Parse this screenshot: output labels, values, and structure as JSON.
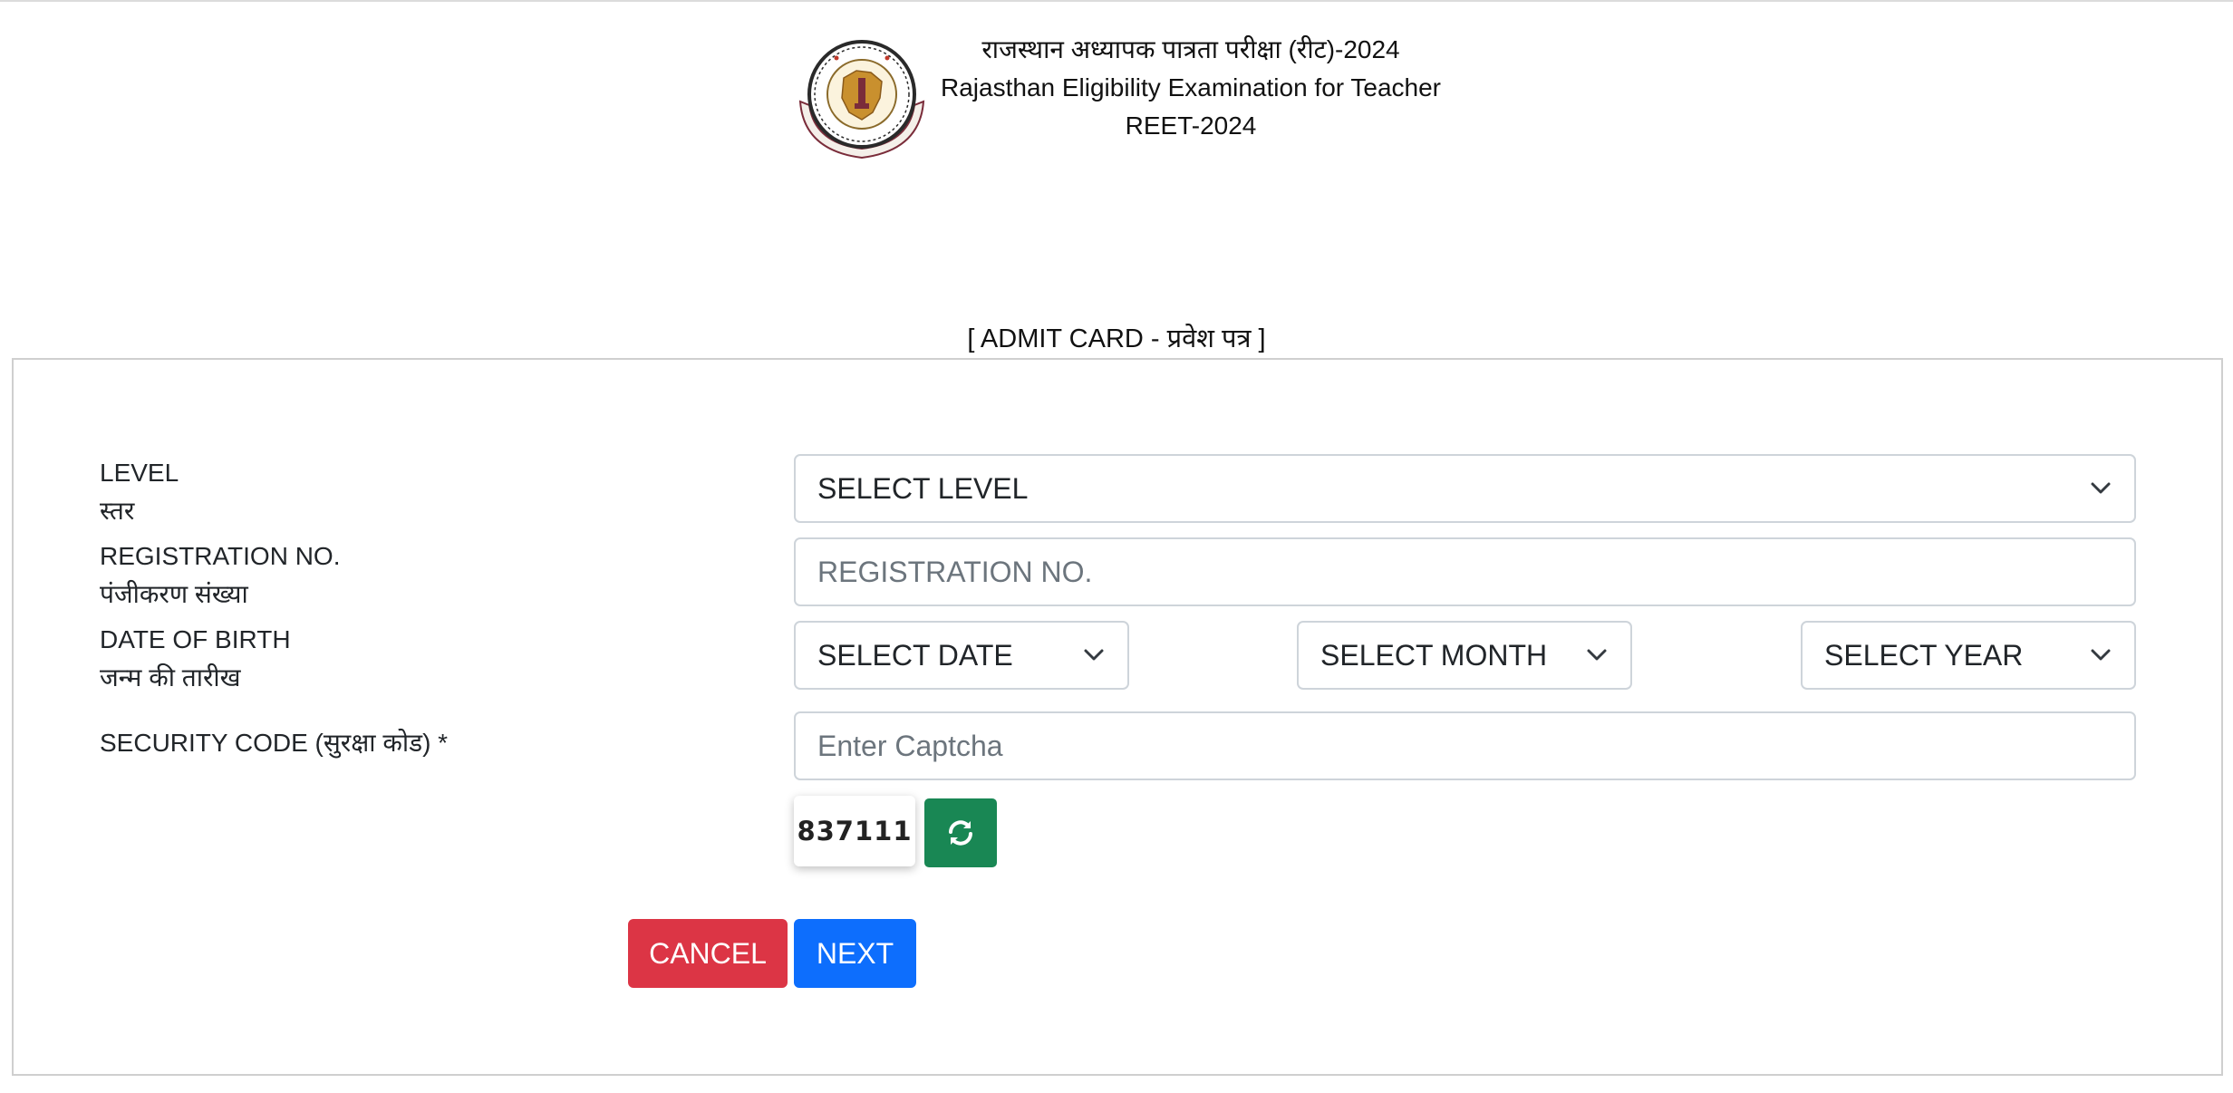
{
  "header": {
    "title_hindi": "राजस्थान अध्यापक पात्रता परीक्षा (रीट)-2024",
    "title_english": "Rajasthan Eligibility Examination for Teacher",
    "title_short": "REET-2024",
    "logo_icon": "board-of-secondary-education-rajasthan-seal"
  },
  "section_title": "[ ADMIT CARD - प्रवेश पत्र ]",
  "form": {
    "level": {
      "label_en": "LEVEL",
      "label_hi": "स्तर",
      "selected": "SELECT LEVEL"
    },
    "registration": {
      "label_en": "REGISTRATION NO.",
      "label_hi": "पंजीकरण संख्या",
      "placeholder": "REGISTRATION NO."
    },
    "dob": {
      "label_en": "DATE OF BIRTH",
      "label_hi": "जन्म की तारीख",
      "date_selected": "SELECT DATE",
      "month_selected": "SELECT MONTH",
      "year_selected": "SELECT YEAR"
    },
    "security": {
      "label": "SECURITY CODE (सुरक्षा कोड) *",
      "placeholder": "Enter Captcha",
      "captcha_value": "837111",
      "refresh_icon": "refresh-icon"
    },
    "buttons": {
      "cancel": "CANCEL",
      "next": "NEXT"
    }
  },
  "colors": {
    "cancel": "#dc3545",
    "next": "#0d6efd",
    "refresh": "#198754",
    "border": "#ced4da"
  }
}
